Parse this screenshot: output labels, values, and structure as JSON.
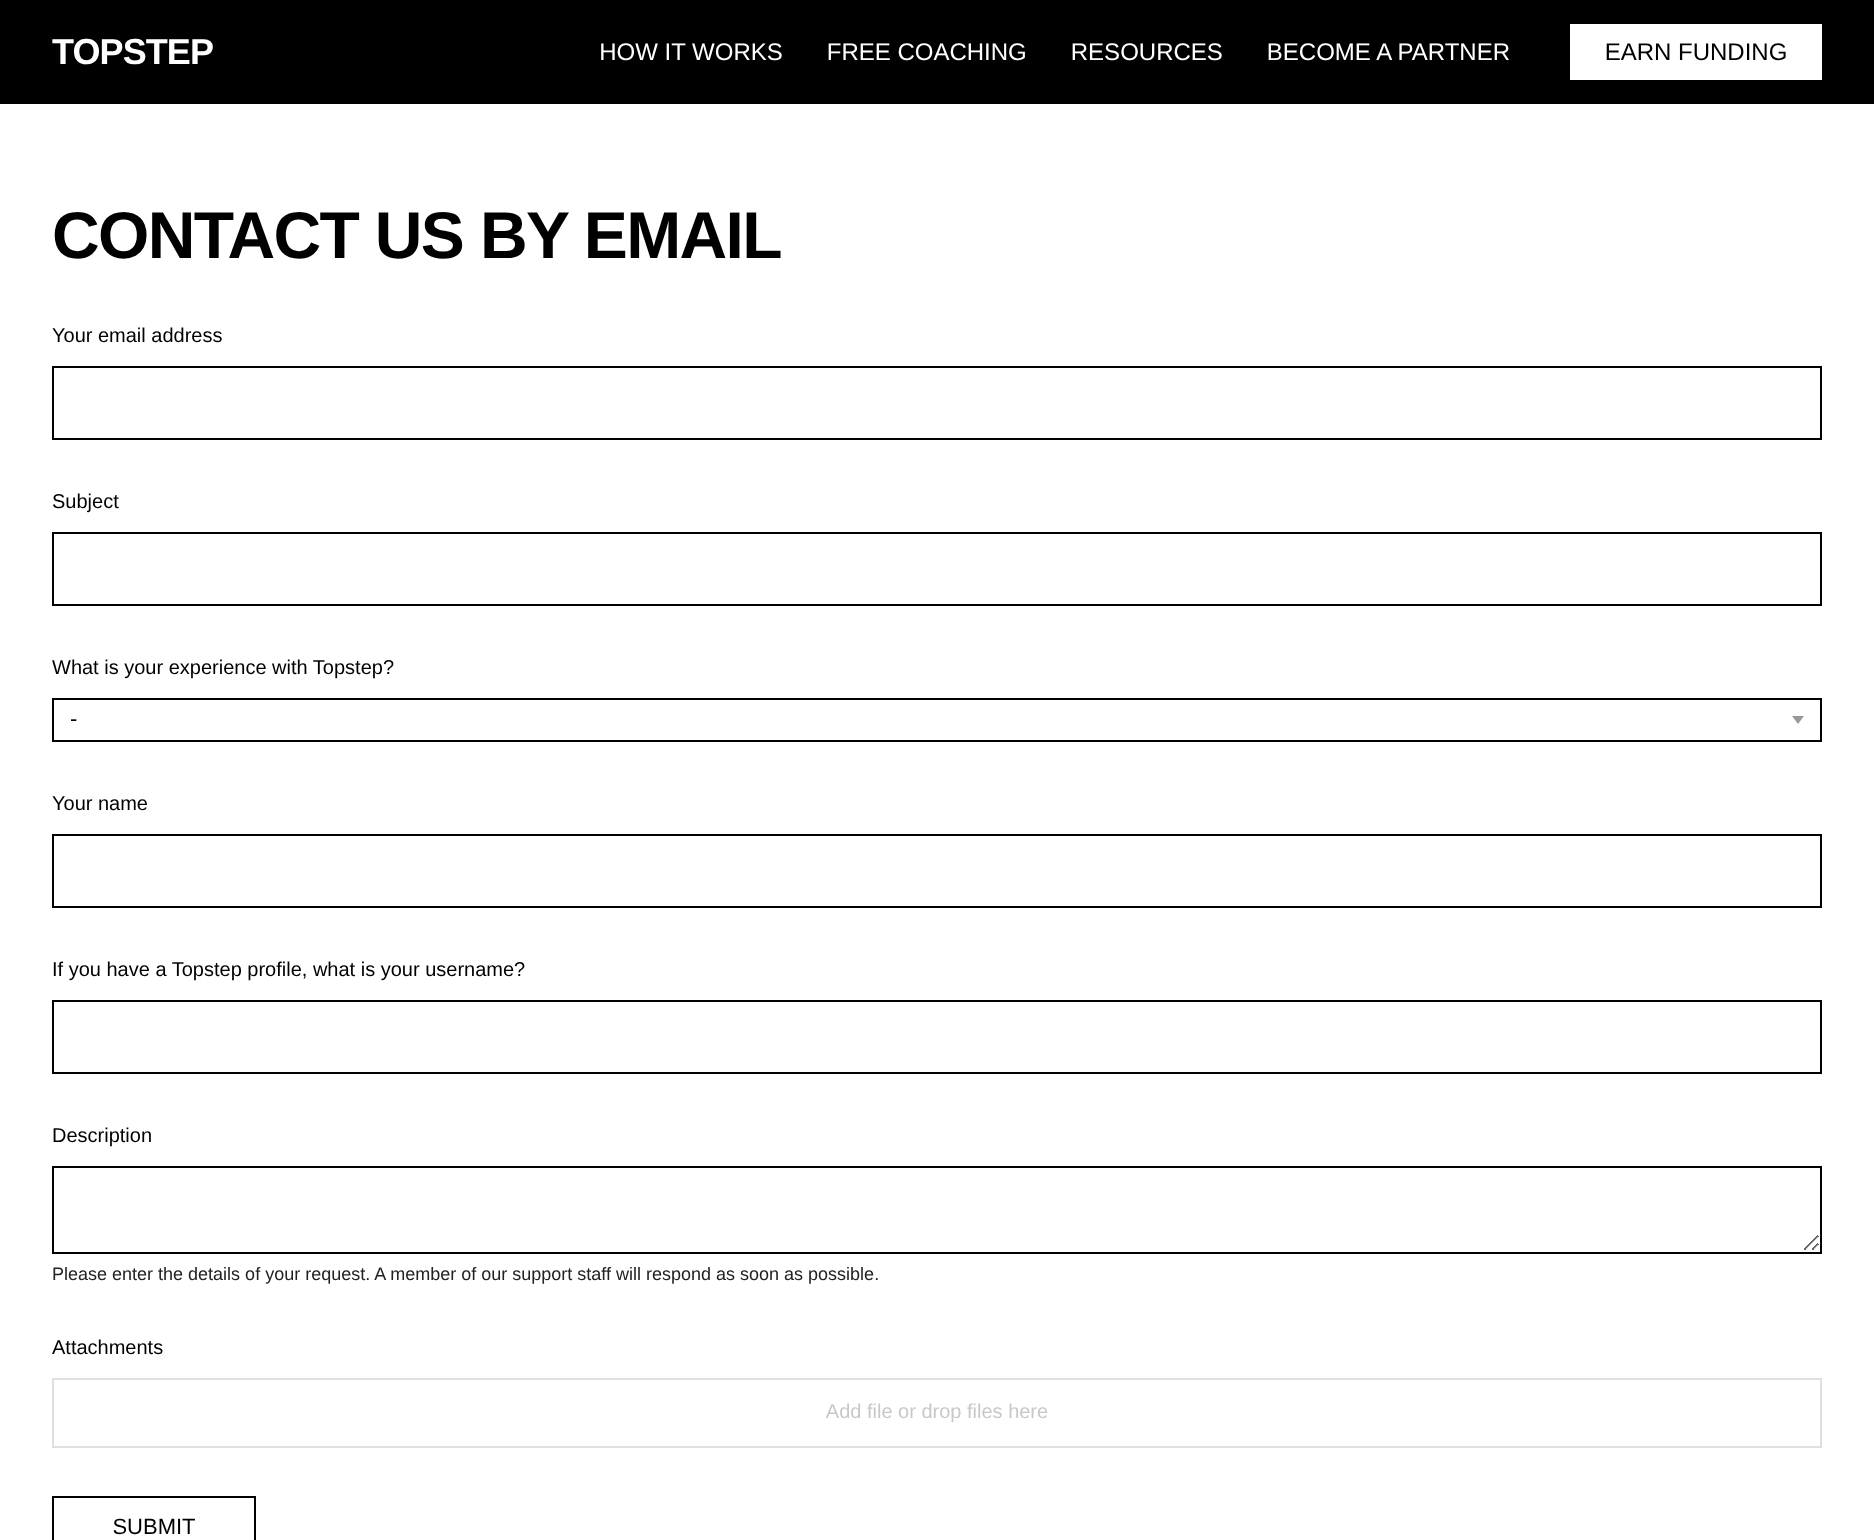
{
  "header": {
    "logo": "TOPSTEP",
    "nav": [
      "HOW IT WORKS",
      "FREE COACHING",
      "RESOURCES",
      "BECOME A PARTNER"
    ],
    "cta": "EARN FUNDING"
  },
  "title": "CONTACT US BY EMAIL",
  "fields": [
    {
      "kind": "text",
      "label": "Your email address"
    },
    {
      "kind": "text",
      "label": "Subject"
    },
    {
      "kind": "select",
      "label": "What is your experience with Topstep?",
      "value": "-"
    },
    {
      "kind": "text",
      "label": "Your name"
    },
    {
      "kind": "text",
      "label": "If you have a Topstep profile, what is your username?"
    },
    {
      "kind": "textarea",
      "label": "Description",
      "help": "Please enter the details of your request. A member of our support staff will respond as soon as possible."
    },
    {
      "kind": "dropzone",
      "label": "Attachments",
      "placeholder": "Add file or drop files here"
    }
  ],
  "submit": "SUBMIT"
}
